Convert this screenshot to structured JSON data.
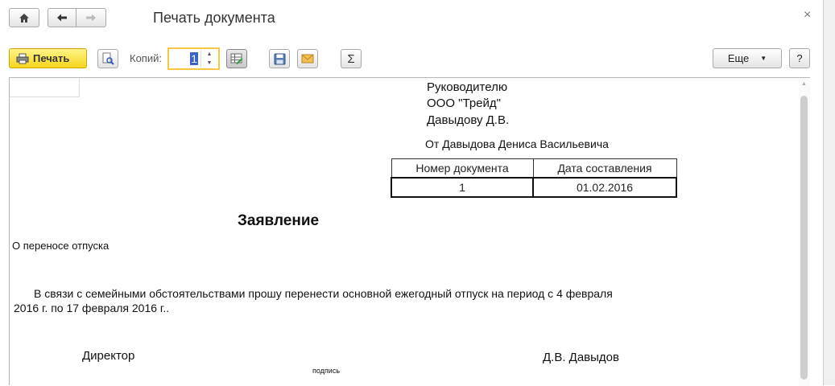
{
  "window": {
    "title": "Печать документа",
    "icons": {
      "home": "home-icon",
      "back": "arrow-left-icon",
      "forward": "arrow-right-icon",
      "close": "close-icon"
    }
  },
  "toolbar": {
    "print_label": "Печать",
    "copies_label": "Копий:",
    "copies_value": "1",
    "more_label": "Еще",
    "help_label": "?",
    "icons": [
      "print-icon",
      "preview-icon",
      "edit-table-icon",
      "save-icon",
      "email-icon",
      "sum-icon"
    ],
    "accent_color": "#f6d51c"
  },
  "document": {
    "addressee": [
      "Руководителю",
      "ООО \"Трейд\"",
      "Давыдову Д.В."
    ],
    "from_line": "От Давыдова Дениса Васильевича",
    "table": {
      "headers": [
        "Номер документа",
        "Дата составления"
      ],
      "row": [
        "1",
        "01.02.2016"
      ]
    },
    "heading": "Заявление",
    "subject": "О переносе отпуска",
    "body_line1": "В связи с семейными обстоятельствами прошу перенести основной ежегодный отпуск на период с 4 февраля",
    "body_line2": "2016 г. по 17 февраля 2016 г..",
    "position": "Директор",
    "signature_caption": "подпись",
    "signer": "Д.В. Давыдов"
  }
}
